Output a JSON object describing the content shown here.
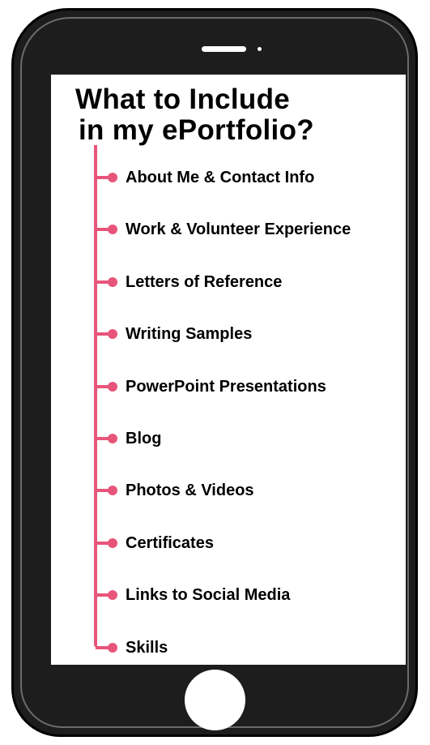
{
  "title": {
    "line1": "What to Include",
    "line2": "in my ePortfolio?"
  },
  "items": [
    {
      "label": "About Me & Contact Info"
    },
    {
      "label": "Work & Volunteer Experience"
    },
    {
      "label": "Letters of Reference"
    },
    {
      "label": "Writing Samples"
    },
    {
      "label": "PowerPoint Presentations"
    },
    {
      "label": "Blog"
    },
    {
      "label": "Photos & Videos"
    },
    {
      "label": "Certificates"
    },
    {
      "label": "Links to Social Media"
    },
    {
      "label": "Skills"
    }
  ],
  "colors": {
    "accent": "#e8557a",
    "phone_body": "#1d1d1d",
    "screen": "#ffffff",
    "text": "#000000"
  }
}
